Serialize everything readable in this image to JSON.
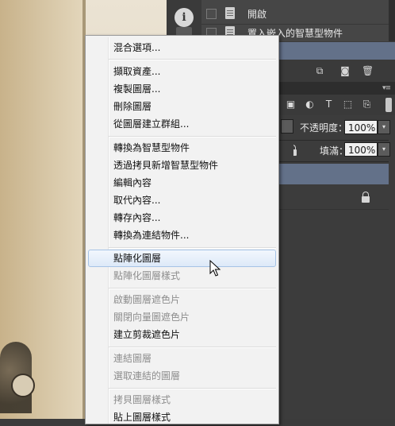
{
  "layers_panel": {
    "top_items": [
      {
        "label": "開啟"
      },
      {
        "label": "置入嵌入的智慧型物件"
      }
    ],
    "opacity_label": "不透明度：",
    "opacity_value": "100%",
    "fill_label": "填滿：",
    "fill_value": "100%"
  },
  "context_menu": {
    "items": [
      {
        "label": "混合選項...",
        "disabled": false
      },
      {
        "label": "擷取資產...",
        "disabled": false
      },
      {
        "label": "複製圖層...",
        "disabled": false
      },
      {
        "label": "刪除圖層",
        "disabled": false
      },
      {
        "label": "從圖層建立群組...",
        "disabled": false
      },
      {
        "label": "轉換為智慧型物件",
        "disabled": false
      },
      {
        "label": "透過拷貝新增智慧型物件",
        "disabled": false
      },
      {
        "label": "編輯內容",
        "disabled": false
      },
      {
        "label": "取代內容...",
        "disabled": false
      },
      {
        "label": "轉存內容...",
        "disabled": false
      },
      {
        "label": "轉換為連結物件...",
        "disabled": false
      },
      {
        "label": "點陣化圖層",
        "disabled": false,
        "highlighted": true
      },
      {
        "label": "點陣化圖層樣式",
        "disabled": true
      },
      {
        "label": "啟動圖層遮色片",
        "disabled": true
      },
      {
        "label": "關閉向量圖遮色片",
        "disabled": true
      },
      {
        "label": "建立剪裁遮色片",
        "disabled": false
      },
      {
        "label": "連結圖層",
        "disabled": true
      },
      {
        "label": "選取連結的圖層",
        "disabled": true
      },
      {
        "label": "拷貝圖層樣式",
        "disabled": true
      },
      {
        "label": "貼上圖層樣式",
        "disabled": false
      }
    ]
  },
  "colors": {
    "panel_bg": "#3c3c3c",
    "selection_blue": "#637189",
    "menu_bg": "#f2f2f2",
    "menu_highlight_border": "#a6c3e6"
  }
}
